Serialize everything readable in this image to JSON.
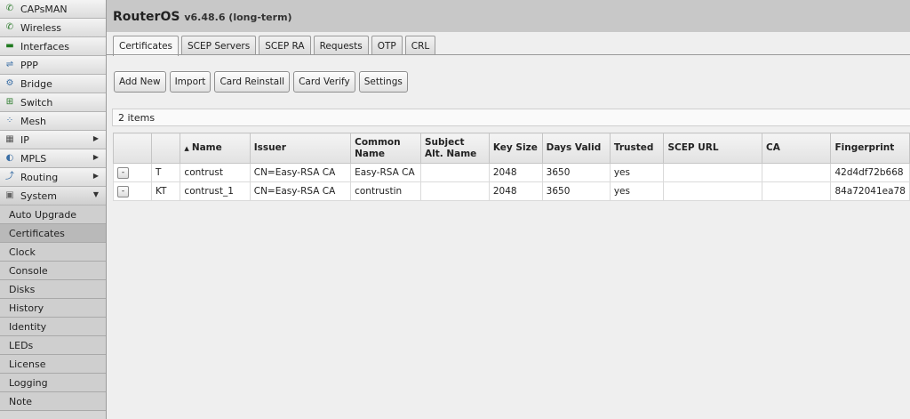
{
  "app": {
    "title": "RouterOS",
    "version": "v6.48.6 (long-term)"
  },
  "sidebar": {
    "items": [
      {
        "label": "CAPsMAN",
        "icon": "capsman-icon"
      },
      {
        "label": "Wireless",
        "icon": "wireless-icon"
      },
      {
        "label": "Interfaces",
        "icon": "interfaces-icon"
      },
      {
        "label": "PPP",
        "icon": "ppp-icon"
      },
      {
        "label": "Bridge",
        "icon": "bridge-icon"
      },
      {
        "label": "Switch",
        "icon": "switch-icon"
      },
      {
        "label": "Mesh",
        "icon": "mesh-icon"
      },
      {
        "label": "IP",
        "icon": "ip-icon",
        "arrow": "▶"
      },
      {
        "label": "MPLS",
        "icon": "mpls-icon",
        "arrow": "▶"
      },
      {
        "label": "Routing",
        "icon": "routing-icon",
        "arrow": "▶"
      },
      {
        "label": "System",
        "icon": "system-icon",
        "arrow": "▼"
      }
    ],
    "subitems": [
      {
        "label": "Auto Upgrade"
      },
      {
        "label": "Certificates",
        "active": true
      },
      {
        "label": "Clock"
      },
      {
        "label": "Console"
      },
      {
        "label": "Disks"
      },
      {
        "label": "History"
      },
      {
        "label": "Identity"
      },
      {
        "label": "LEDs"
      },
      {
        "label": "License"
      },
      {
        "label": "Logging"
      },
      {
        "label": "Note"
      }
    ]
  },
  "tabs": [
    {
      "label": "Certificates",
      "active": true
    },
    {
      "label": "SCEP Servers"
    },
    {
      "label": "SCEP RA"
    },
    {
      "label": "Requests"
    },
    {
      "label": "OTP"
    },
    {
      "label": "CRL"
    }
  ],
  "toolbar": {
    "add_new": "Add New",
    "import": "Import",
    "card_reinstall": "Card Reinstall",
    "card_verify": "Card Verify",
    "settings": "Settings"
  },
  "list": {
    "count_label": "2 items",
    "sort_indicator": "▲",
    "columns": {
      "btn": "",
      "flags": "",
      "name": "Name",
      "issuer": "Issuer",
      "common_name": "Common Name",
      "subject_alt_name": "Subject Alt. Name",
      "key_size": "Key Size",
      "days_valid": "Days Valid",
      "trusted": "Trusted",
      "scep_url": "SCEP URL",
      "ca": "CA",
      "fingerprint": "Fingerprint"
    },
    "rows": [
      {
        "btn": "-",
        "flags": "T",
        "name": "contrust",
        "issuer": "CN=Easy-RSA CA",
        "common_name": "Easy-RSA CA",
        "subject_alt_name": "",
        "key_size": "2048",
        "days_valid": "3650",
        "trusted": "yes",
        "scep_url": "",
        "ca": "",
        "fingerprint": "42d4df72b668"
      },
      {
        "btn": "-",
        "flags": "KT",
        "name": "contrust_1",
        "issuer": "CN=Easy-RSA CA",
        "common_name": "contrustin",
        "subject_alt_name": "",
        "key_size": "2048",
        "days_valid": "3650",
        "trusted": "yes",
        "scep_url": "",
        "ca": "",
        "fingerprint": "84a72041ea78"
      }
    ]
  }
}
